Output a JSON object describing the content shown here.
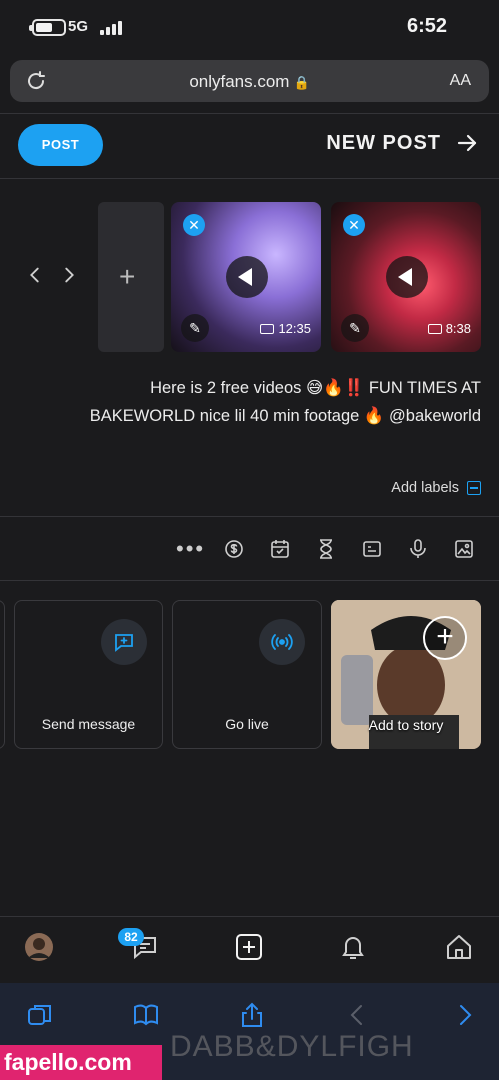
{
  "status_bar": {
    "network": "5G",
    "time": "6:52"
  },
  "browser": {
    "url": "onlyfans.com",
    "text_size_label": "AA"
  },
  "header": {
    "title": "NEW POST",
    "post_button": "POST"
  },
  "media": [
    {
      "duration": "8:38"
    },
    {
      "duration": "12:35"
    }
  ],
  "caption": {
    "line1": "Here is 2 free videos 😅🔥‼️ FUN TIMES AT",
    "line2": "BAKEWORLD nice lil 40 min footage 🔥 @bakeworld"
  },
  "labels": {
    "add_labels": "Add labels"
  },
  "cards": {
    "story": "Add to story",
    "live": "Go live",
    "message": "Send message"
  },
  "nav": {
    "messages_badge": "82"
  },
  "overlay": {
    "ghost_text": "DABB&DYLFIGH",
    "watermark": "fapello.com"
  },
  "colors": {
    "accent": "#1da1f2",
    "background": "#1b1b1d",
    "watermark": "#e0246f"
  }
}
